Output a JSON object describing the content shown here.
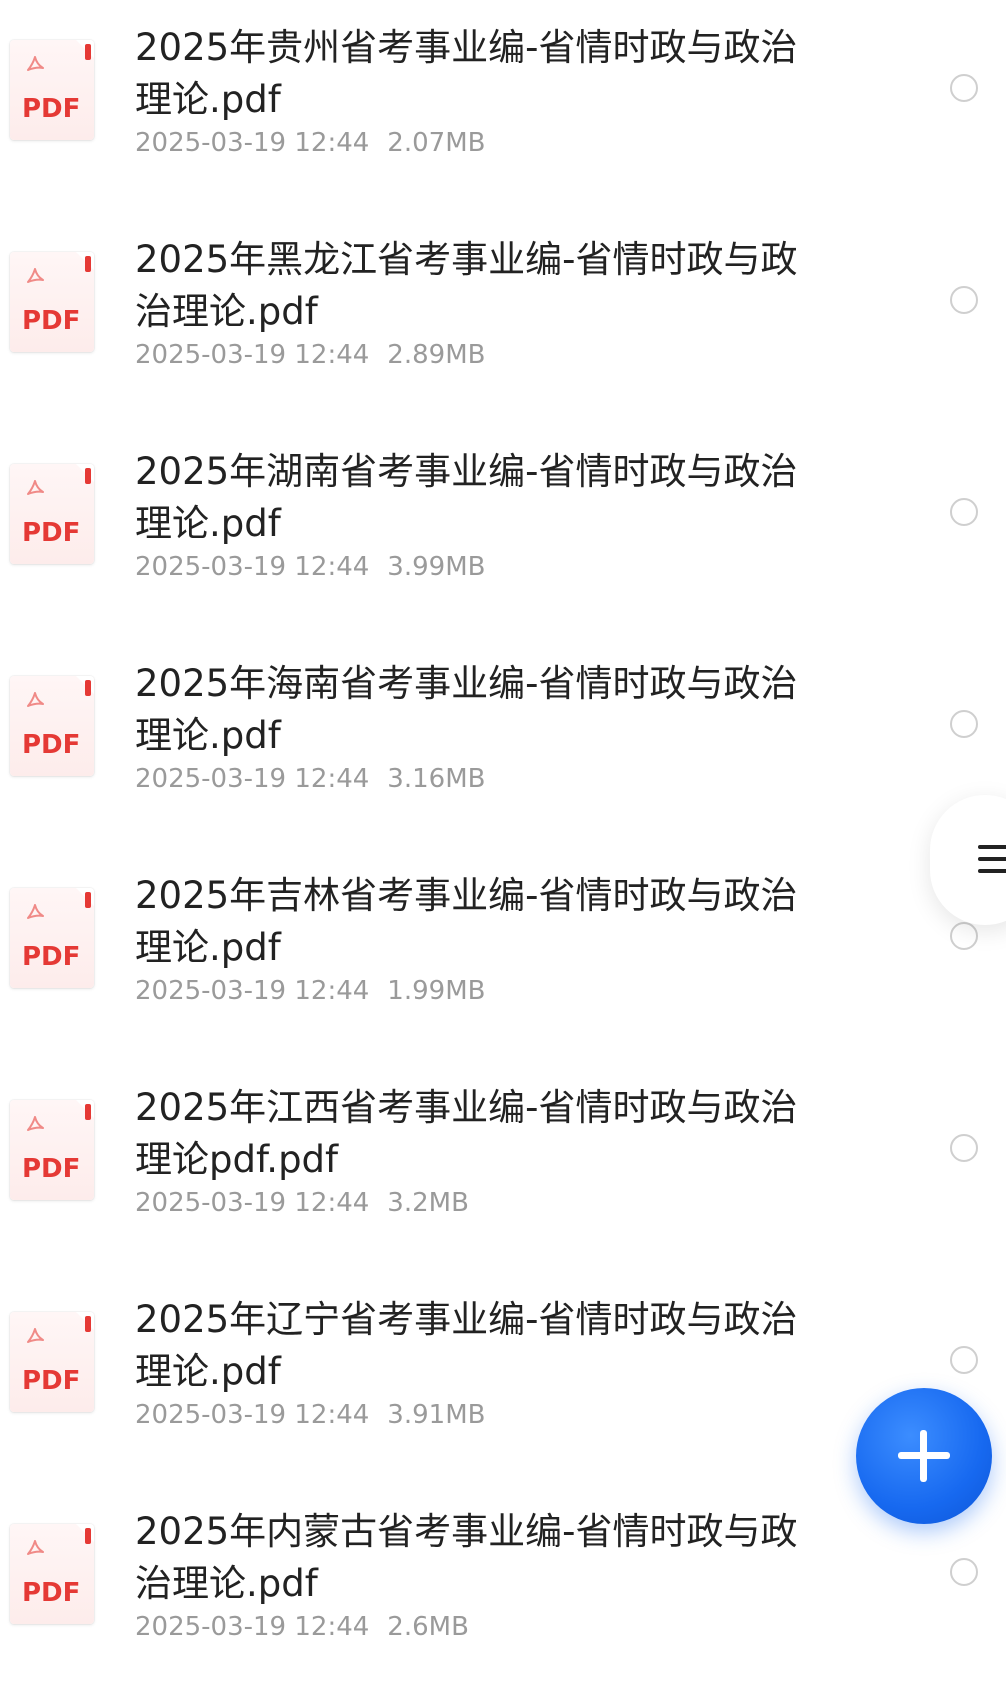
{
  "files": [
    {
      "name": "2025年贵州省考事业编-省情时政与政治理论.pdf",
      "date": "2025-03-19 12:44",
      "size": "2.07MB",
      "icon": "pdf-file-icon"
    },
    {
      "name": "2025年黑龙江省考事业编-省情时政与政治理论.pdf",
      "date": "2025-03-19 12:44",
      "size": "2.89MB",
      "icon": "pdf-file-icon"
    },
    {
      "name": "2025年湖南省考事业编-省情时政与政治理论.pdf",
      "date": "2025-03-19 12:44",
      "size": "3.99MB",
      "icon": "pdf-file-icon"
    },
    {
      "name": "2025年海南省考事业编-省情时政与政治理论.pdf",
      "date": "2025-03-19 12:44",
      "size": "3.16MB",
      "icon": "pdf-file-icon"
    },
    {
      "name": "2025年吉林省考事业编-省情时政与政治理论.pdf",
      "date": "2025-03-19 12:44",
      "size": "1.99MB",
      "icon": "pdf-file-icon"
    },
    {
      "name": "2025年江西省考事业编-省情时政与政治理论pdf.pdf",
      "date": "2025-03-19 12:44",
      "size": "3.2MB",
      "icon": "pdf-file-icon"
    },
    {
      "name": "2025年辽宁省考事业编-省情时政与政治理论.pdf",
      "date": "2025-03-19 12:44",
      "size": "3.91MB",
      "icon": "pdf-file-icon"
    },
    {
      "name": "2025年内蒙古省考事业编-省情时政与政治理论.pdf",
      "date": "2025-03-19 12:44",
      "size": "2.6MB",
      "icon": "pdf-file-icon"
    }
  ],
  "pdf_icon_label": "PDF",
  "side_handle": {
    "icon": "menu-lines-icon"
  },
  "fab": {
    "icon": "plus-icon",
    "color": "#1769f0"
  },
  "colors": {
    "pdf_red": "#e53935",
    "text_primary": "#222222",
    "text_secondary": "#9a9a9a",
    "radio_border": "#cfcfcf"
  }
}
